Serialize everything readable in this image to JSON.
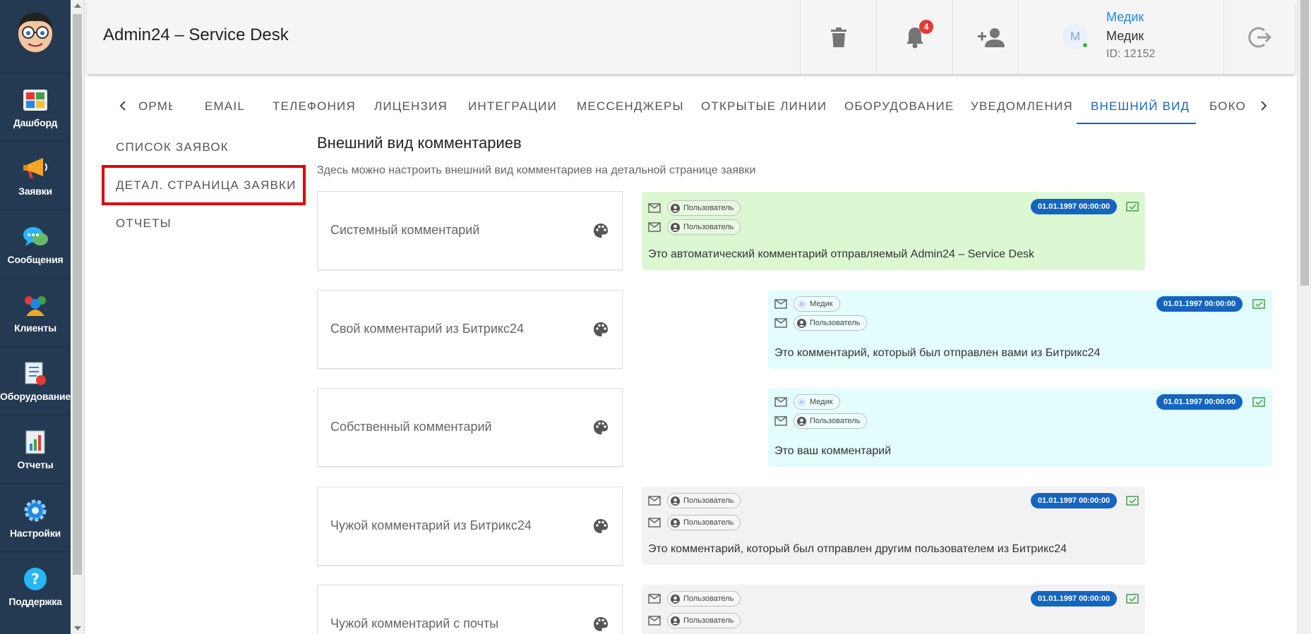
{
  "nav": {
    "items": [
      {
        "label": "Дашборд",
        "icon": "dashboard-icon"
      },
      {
        "label": "Заявки",
        "icon": "megaphone-icon"
      },
      {
        "label": "Сообщения",
        "icon": "chat-bubbles-icon"
      },
      {
        "label": "Клиенты",
        "icon": "clients-icon"
      },
      {
        "label": "Оборудование",
        "icon": "equipment-checklist-icon"
      },
      {
        "label": "Отчеты",
        "icon": "report-chart-icon"
      },
      {
        "label": "Настройки",
        "icon": "gear-icon"
      },
      {
        "label": "Поддержка",
        "icon": "question-icon"
      }
    ]
  },
  "header": {
    "title": "Admin24 – Service Desk",
    "notifications_count": "4",
    "user": {
      "avatar_letter": "М",
      "link": "Медик",
      "name": "Медик",
      "id": "ID: 12152"
    }
  },
  "tabs": {
    "items": [
      "ОРМЫ",
      "EMAIL",
      "ТЕЛЕФОНИЯ",
      "ЛИЦЕНЗИЯ",
      "ИНТЕГРАЦИИ",
      "МЕССЕНДЖЕРЫ",
      "ОТКРЫТЫЕ ЛИНИИ",
      "ОБОРУДОВАНИЕ",
      "УВЕДОМЛЕНИЯ",
      "ВНЕШНИЙ ВИД",
      "БОКО"
    ],
    "active": "ВНЕШНИЙ ВИД"
  },
  "submenu": {
    "items": [
      "СПИСОК ЗАЯВОК",
      "ДЕТАЛ. СТРАНИЦА ЗАЯВКИ",
      "ОТЧЕТЫ"
    ],
    "selected": "ДЕТАЛ. СТРАНИЦА ЗАЯВКИ"
  },
  "content": {
    "title": "Внешний вид комментариев",
    "description": "Здесь можно настроить внешний вид комментариев на детальной странице заявки",
    "settings": [
      {
        "label": "Системный комментарий"
      },
      {
        "label": "Свой комментарий из Битрикс24"
      },
      {
        "label": "Собственный комментарий"
      },
      {
        "label": "Чужой комментарий из Битрикс24"
      },
      {
        "label": "Чужой комментарий с почты"
      }
    ],
    "previews": [
      {
        "from": "Пользователь",
        "to": "Пользователь",
        "date": "01.01.1997 00:00:00",
        "text": "Это автоматический комментарий отправляемый Admin24 – Service Desk",
        "bg": "#dcf8d2"
      },
      {
        "from": "Медик",
        "to": "Пользователь",
        "date": "01.01.1997 00:00:00",
        "text": "Это комментарий, который был отправлен вами из Битрикс24",
        "bg": "#e3fcfc"
      },
      {
        "from": "Медик",
        "to": "Пользователь",
        "date": "01.01.1997 00:00:00",
        "text": "Это ваш комментарий",
        "bg": "#e3fcfc"
      },
      {
        "from": "Пользователь",
        "to": "Пользователь",
        "date": "01.01.1997 00:00:00",
        "text": "Это комментарий, который был отправлен другим пользователем из Битрикс24",
        "bg": "#f2f2f2"
      },
      {
        "from": "Пользователь",
        "to": "Пользователь",
        "date": "01.01.1997 00:00:00",
        "text": "",
        "bg": "#f2f2f2"
      }
    ]
  },
  "colors": {
    "nav_bg": "#243a52",
    "accent": "#1565c0",
    "highlight_box": "#e00000",
    "badge": "#e53935",
    "sent_icon": "#43a047"
  }
}
